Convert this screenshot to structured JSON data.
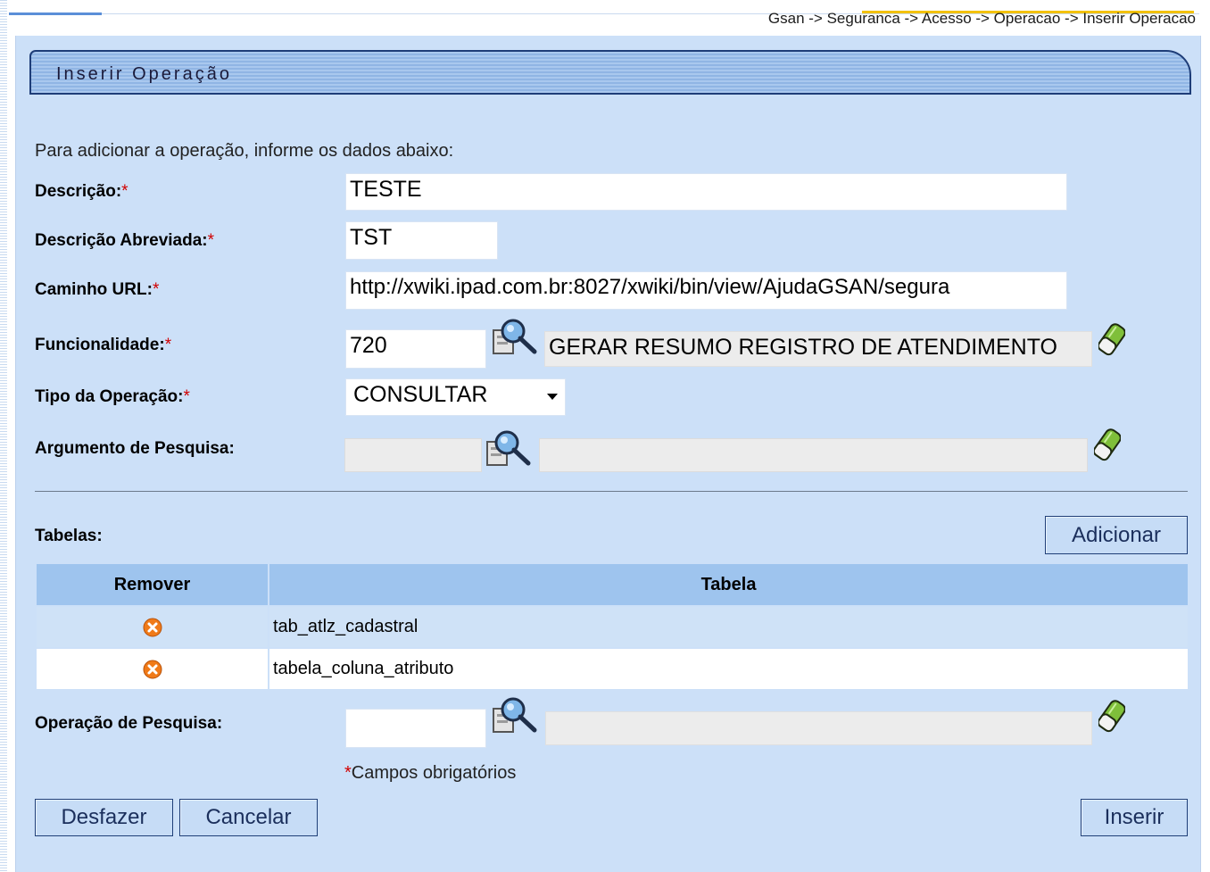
{
  "breadcrumb": "Gsan -> Seguranca -> Acesso -> Operacao -> Inserir Operacao",
  "title": "Inserir Operação",
  "intro": "Para adicionar a operação, informe os dados abaixo:",
  "required_mark": "*",
  "fields": {
    "descricao": {
      "label": "Descrição:",
      "value": "TESTE"
    },
    "descricao_abreviada": {
      "label": "Descrição Abreviada:",
      "value": "TST"
    },
    "caminho_url": {
      "label": "Caminho URL:",
      "value": "http://xwiki.ipad.com.br:8027/xwiki/bin/view/AjudaGSAN/segura"
    },
    "funcionalidade": {
      "label": "Funcionalidade:",
      "code": "720",
      "description": "GERAR RESUMO REGISTRO DE ATENDIMENTO"
    },
    "tipo_operacao": {
      "label": "Tipo da Operação:",
      "selected": "CONSULTAR"
    },
    "argumento_pesquisa": {
      "label": "Argumento de Pesquisa:",
      "code": "",
      "description": ""
    },
    "operacao_pesquisa": {
      "label": "Operação de Pesquisa:",
      "code": "",
      "description": ""
    }
  },
  "tabelas": {
    "label": "Tabelas:",
    "add_button": "Adicionar",
    "columns": [
      "Remover",
      "Tabela"
    ],
    "rows": [
      {
        "tabela": "tab_atlz_cadastral"
      },
      {
        "tabela": "tabela_coluna_atributo"
      }
    ]
  },
  "required_note": "Campos obrigatórios",
  "buttons": {
    "desfazer": "Desfazer",
    "cancelar": "Cancelar",
    "inserir": "Inserir"
  },
  "icons": {
    "search": "search-icon",
    "eraser": "eraser-icon",
    "remove": "remove-icon"
  },
  "colors": {
    "panel_bg": "#cce0f8",
    "header_bg": "#9ec4ee",
    "button_border": "#1f3f78",
    "required": "#d10000"
  }
}
